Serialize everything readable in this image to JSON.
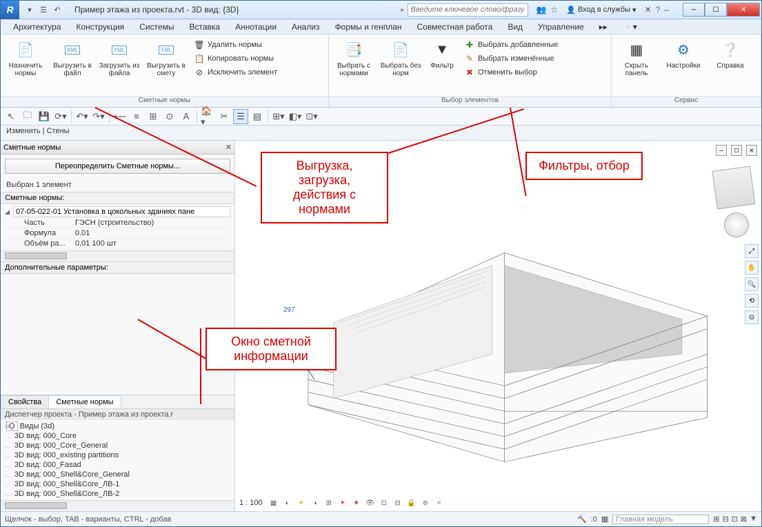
{
  "title": "Пример этажа из проекта.rvt - 3D вид: {3D}",
  "search_placeholder": "Введите ключевое слово/фразу",
  "login": "Вход в службы",
  "menu": [
    "Архитектура",
    "Конструкция",
    "Системы",
    "Вставка",
    "Аннотации",
    "Анализ",
    "Формы и генплан",
    "Совместная работа",
    "Вид",
    "Управление"
  ],
  "ribbon": {
    "group1_label": "Сметные нормы",
    "group2_label": "Выбор элементов",
    "group3_label": "Сервис",
    "assign": "Назначить нормы",
    "export_file": "Выгрузить в файл",
    "import_file": "Загрузить из файла",
    "export_est": "Выгрузить в смету",
    "del_norms": "Удалить  нормы",
    "copy_norms": "Копировать  нормы",
    "excl_elem": "Исключить  элемент",
    "sel_with": "Выбрать с нормами",
    "sel_without": "Выбрать без норм",
    "filter": "Фильтр",
    "sel_added": "Выбрать добавленные",
    "sel_changed": "Выбрать изменённые",
    "cancel_sel": "Отменить выбор",
    "hide_panel": "Скрыть панель",
    "settings": "Настройки",
    "help": "Справка"
  },
  "modtab": "Изменить | Стены",
  "panel": {
    "title": "Сметные нормы",
    "override": "Переопределить Сметные нормы...",
    "selected": "Выбран 1 элемент",
    "section": "Сметные нормы:",
    "norm_code": "07-05-022-01 Установка в цокольных зданиях пане",
    "rows": [
      {
        "k": "Часть",
        "v": "ГЭСН (строительство)"
      },
      {
        "k": "Формула",
        "v": "0.01"
      },
      {
        "k": "Объём ра...",
        "v": "0,01 100 шт"
      }
    ],
    "extra": "Дополнительные параметры:",
    "tab_props": "Свойства",
    "tab_norms": "Сметные нормы"
  },
  "browser": {
    "title": "Диспетчер проекта - Пример этажа из проекта.r",
    "root": "Виды (3d)",
    "items": [
      "3D вид: 000_Core",
      "3D вид: 000_Core_General",
      "3D вид: 000_existing partitions",
      "3D вид: 000_Fasad",
      "3D вид: 000_Shell&Core_General",
      "3D вид: 000_Shell&Core_ЛВ-1",
      "3D вид: 000_Shell&Core_ЛВ-2"
    ]
  },
  "viewport": {
    "scale": "1 : 100",
    "dim": "297"
  },
  "status": {
    "hint": "Щелчок - выбор, TAB - варианты, CTRL - добав",
    "dim": ":0",
    "model": "Главная модель"
  },
  "callouts": {
    "c1": "Выгрузка, загрузка, действия с нормами",
    "c2": "Фильтры, отбор",
    "c3": "Окно сметной информации"
  }
}
